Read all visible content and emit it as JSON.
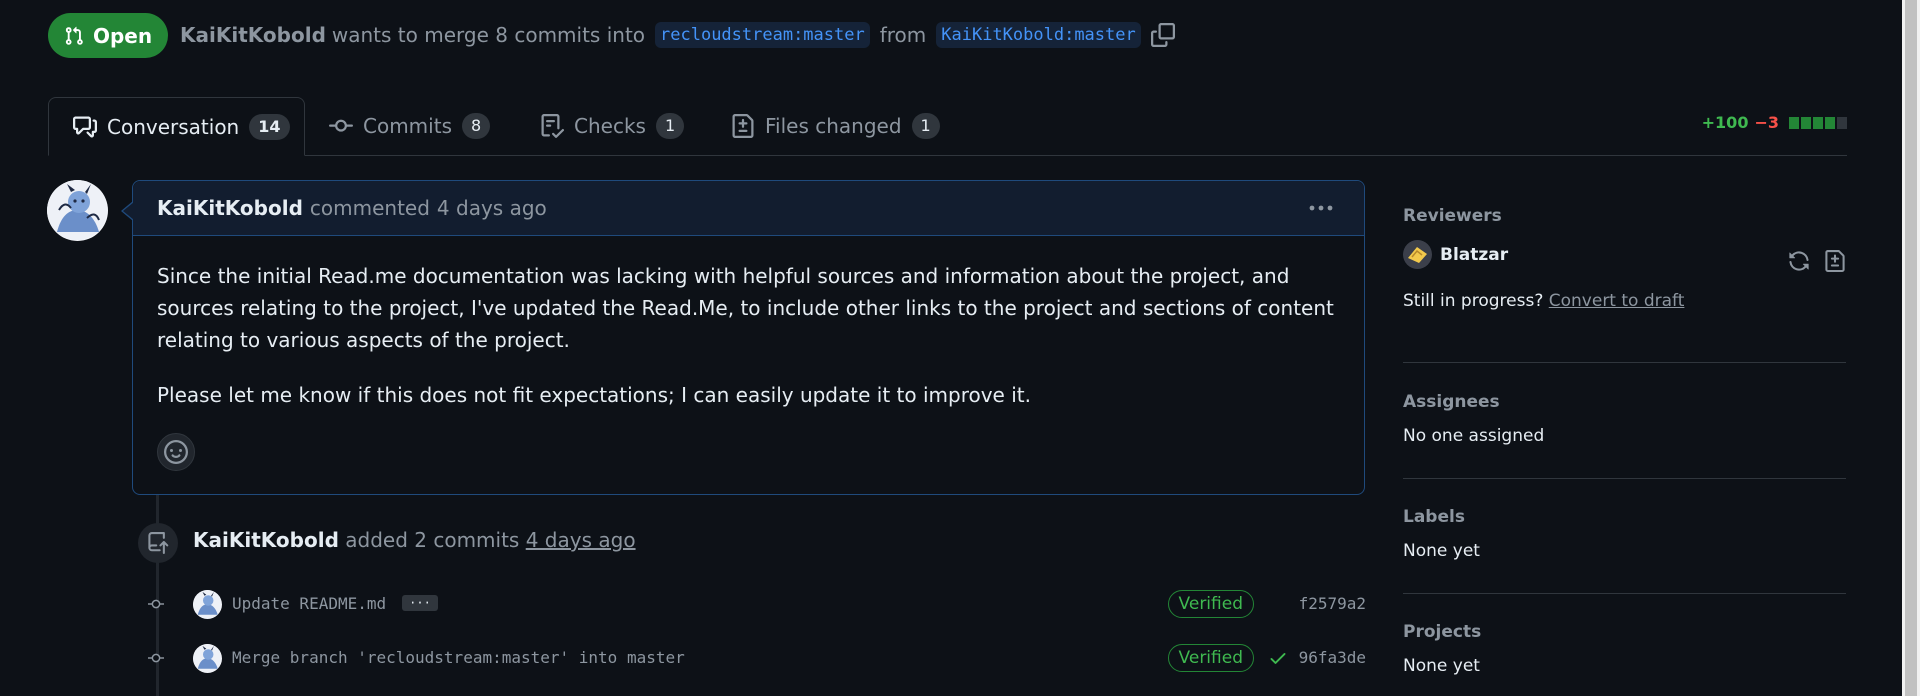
{
  "header": {
    "state_label": "Open",
    "author": "KaiKitKobold",
    "merge_text": "wants to merge 8 commits into",
    "base_branch": "recloudstream:master",
    "from_text": "from",
    "head_branch": "KaiKitKobold:master"
  },
  "tabs": [
    {
      "label": "Conversation",
      "count": "14",
      "icon": "comment-discussion-icon"
    },
    {
      "label": "Commits",
      "count": "8",
      "icon": "git-commit-icon"
    },
    {
      "label": "Checks",
      "count": "1",
      "icon": "checklist-icon"
    },
    {
      "label": "Files changed",
      "count": "1",
      "icon": "file-diff-icon"
    }
  ],
  "diffstat": {
    "additions": "+100",
    "deletions": "−3",
    "blocks": [
      "green",
      "green",
      "green",
      "green",
      "gray"
    ],
    "colors": {
      "green": "#238636",
      "gray": "#30363d"
    }
  },
  "comment": {
    "author": "KaiKitKobold",
    "action": "commented",
    "time": "4 days ago",
    "paragraphs": [
      "Since the initial Read.me documentation was lacking with helpful sources and information about the project, and sources relating to the project, I've updated the Read.Me, to include other links to the project and sections of content relating to various aspects of the project.",
      "Please let me know if this does not fit expectations; I can easily update it to improve it."
    ]
  },
  "timeline": {
    "event": {
      "author": "KaiKitKobold",
      "action": "added 2 commits",
      "time": "4 days ago"
    },
    "commits": [
      {
        "message": "Update README.md",
        "has_more": true,
        "more_label": "···",
        "verified": "Verified",
        "check": false,
        "sha": "f2579a2"
      },
      {
        "message": "Merge branch 'recloudstream:master' into master",
        "has_more": false,
        "verified": "Verified",
        "check": true,
        "sha": "96fa3de"
      }
    ]
  },
  "sidebar": {
    "reviewers": {
      "title": "Reviewers",
      "name": "Blatzar",
      "draft_prompt": "Still in progress?",
      "draft_link": "Convert to draft"
    },
    "assignees": {
      "title": "Assignees",
      "value": "No one assigned"
    },
    "labels": {
      "title": "Labels",
      "value": "None yet"
    },
    "projects": {
      "title": "Projects",
      "value": "None yet"
    }
  },
  "colors": {
    "accent_green": "#238636",
    "link_blue": "#4493f8",
    "bg": "#0d1117",
    "comment_border": "#1f4a7c"
  }
}
